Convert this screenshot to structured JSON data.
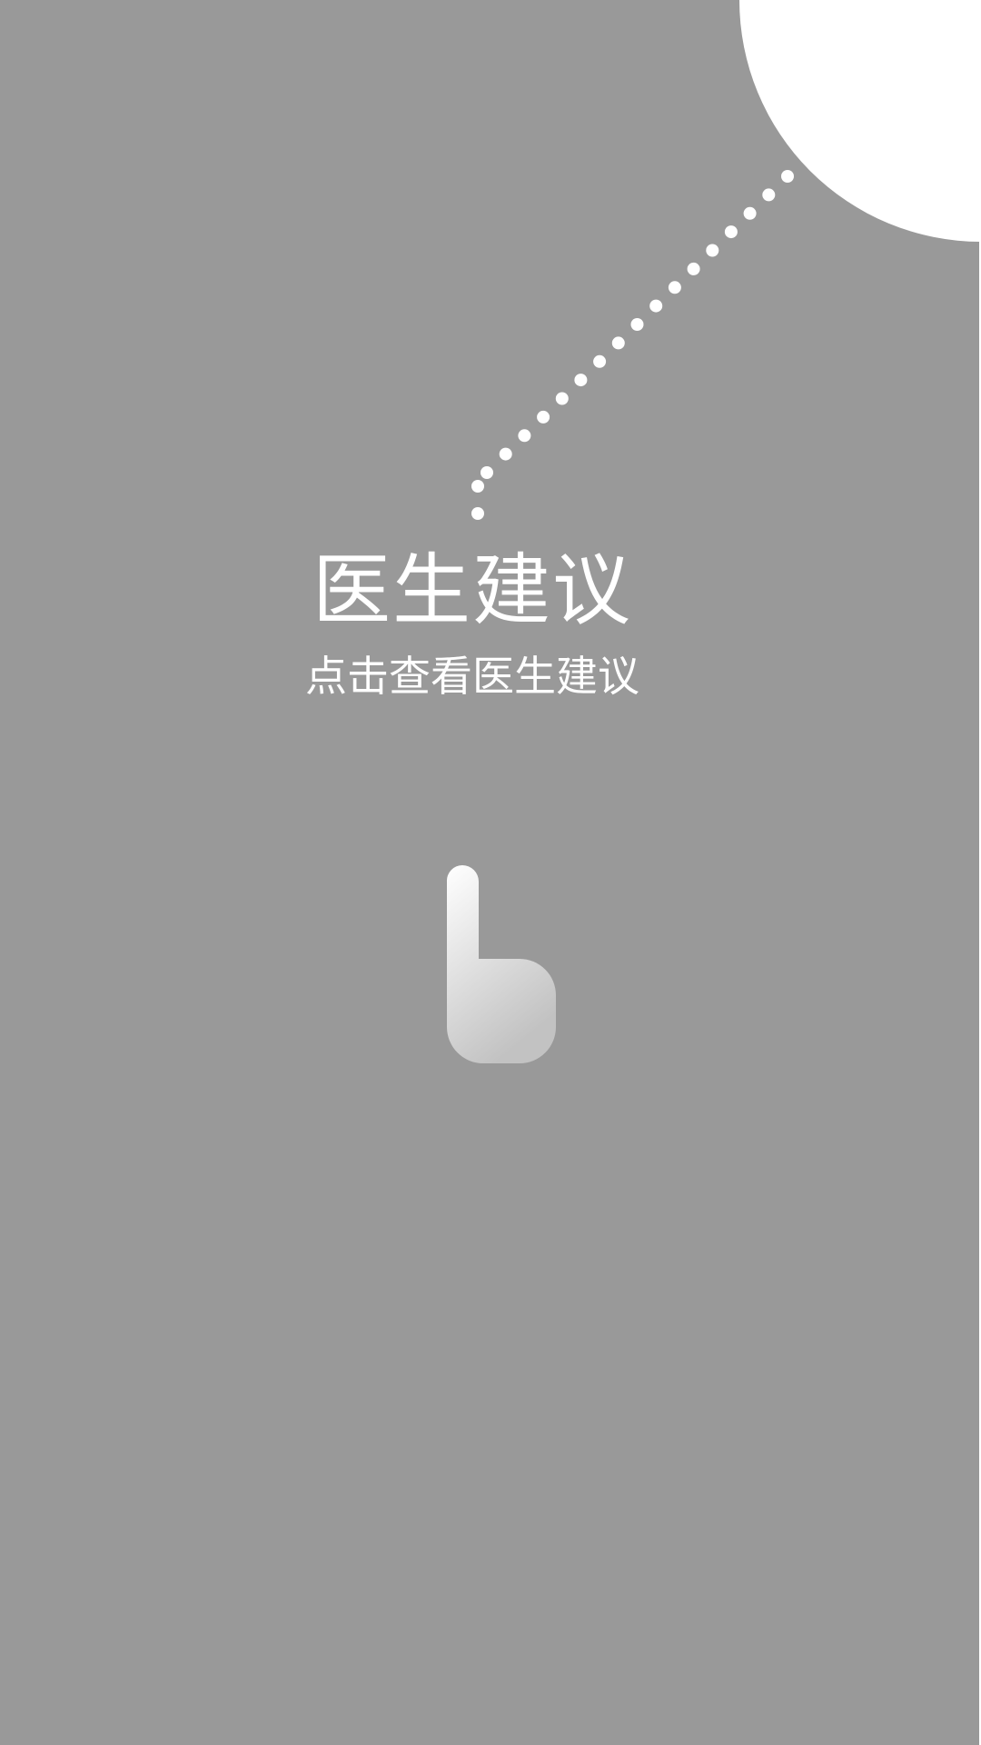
{
  "guide": {
    "title": "医生建议",
    "subtitle": "点击查看医生建议",
    "pointer_icon": "hand-pointer-icon",
    "highlight_shape": "spotlight-circle",
    "path_style": "dotted-line"
  },
  "colors": {
    "overlay": "#999999",
    "highlight": "#ffffff",
    "text": "#ffffff",
    "dots": "#ffffff",
    "hand_gradient_start": "#ffffff",
    "hand_gradient_end": "#c2c2c2"
  }
}
